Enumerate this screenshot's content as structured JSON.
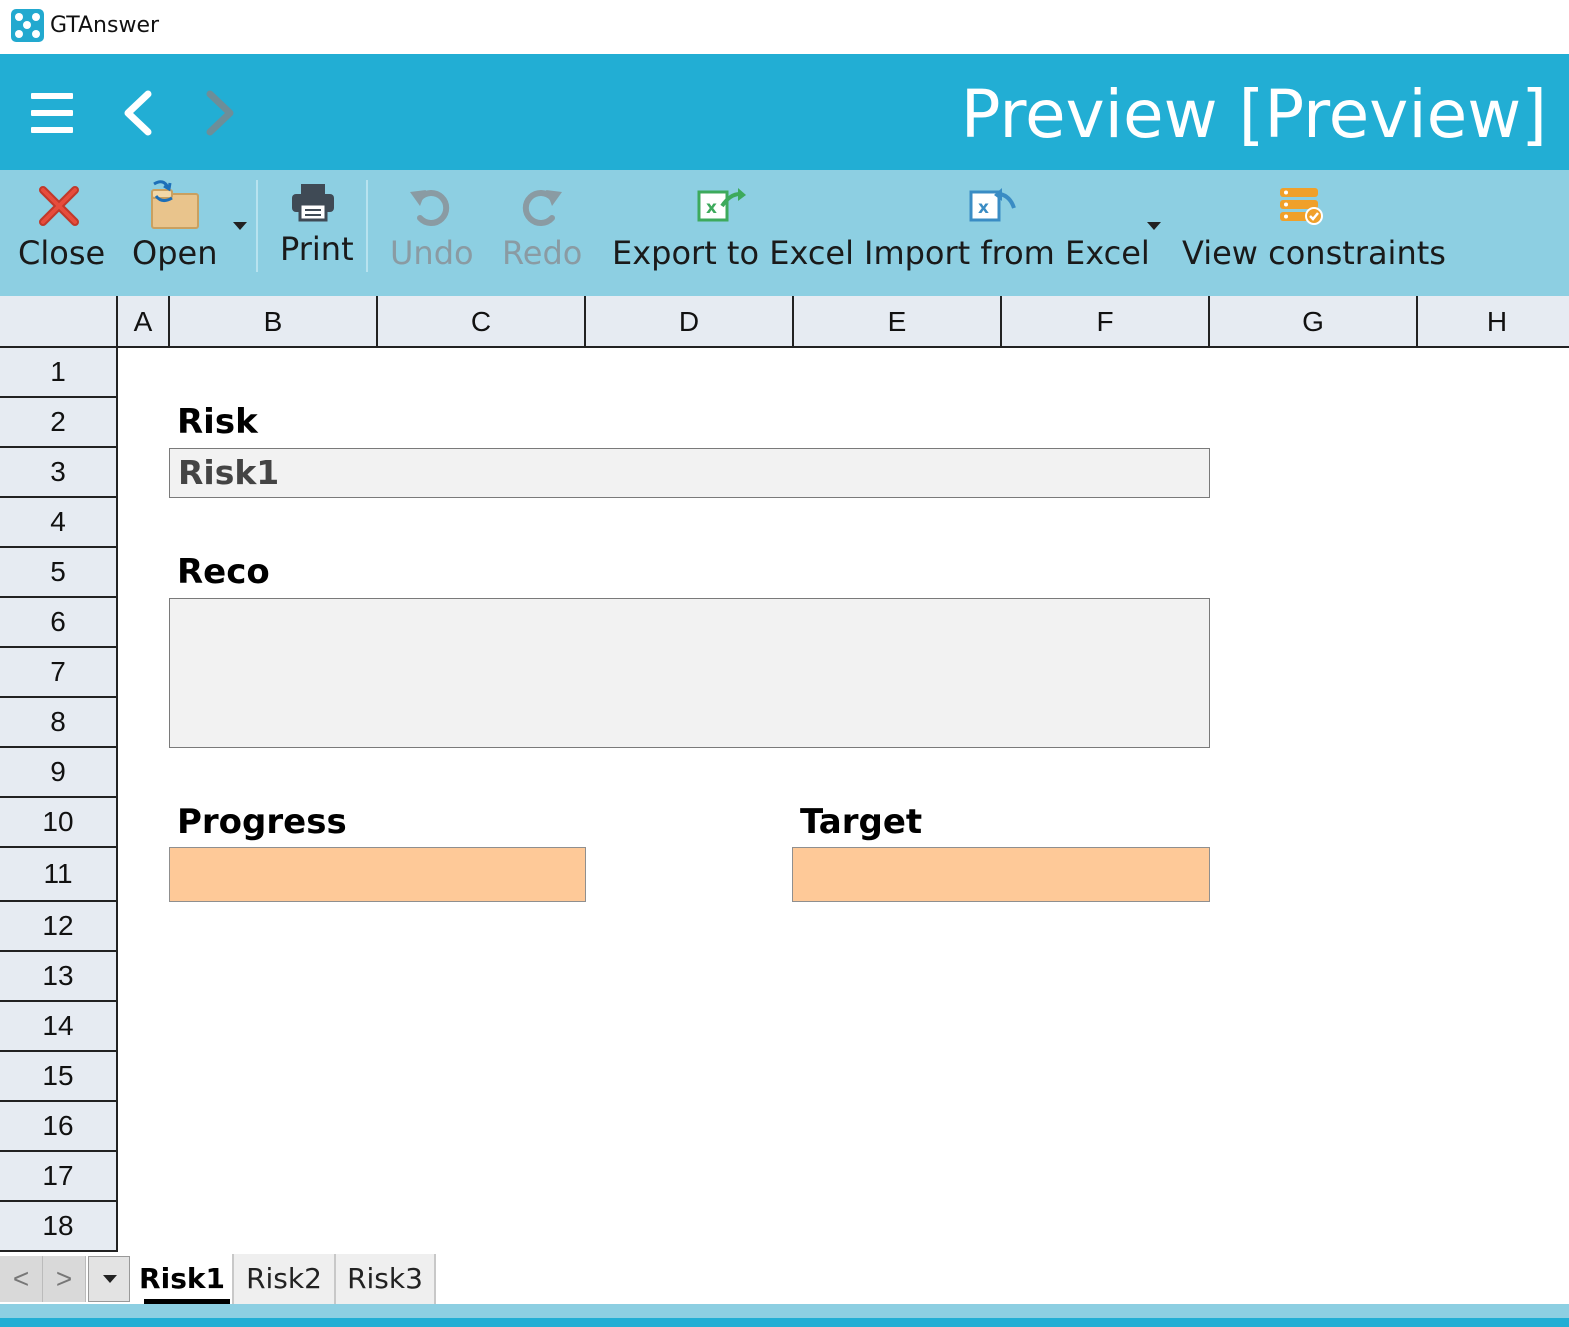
{
  "app": {
    "title": "GTAnswer"
  },
  "header": {
    "title": "Preview [Preview]"
  },
  "toolbar": {
    "close": "Close",
    "open": "Open",
    "print": "Print",
    "undo": "Undo",
    "redo": "Redo",
    "export": "Export to Excel",
    "import": "Import from Excel",
    "constraints": "View constraints"
  },
  "grid": {
    "columns": [
      "A",
      "B",
      "C",
      "D",
      "E",
      "F",
      "G",
      "H"
    ],
    "rows": [
      "1",
      "2",
      "3",
      "4",
      "5",
      "6",
      "7",
      "8",
      "9",
      "10",
      "11",
      "12",
      "13",
      "14",
      "15",
      "16",
      "17",
      "18"
    ]
  },
  "form": {
    "risk_label": "Risk",
    "risk_value": "Risk1",
    "reco_label": "Reco",
    "reco_value": "",
    "progress_label": "Progress",
    "progress_value": "",
    "target_label": "Target",
    "target_value": ""
  },
  "sheets": {
    "prev": "<",
    "next": ">",
    "tabs": [
      "Risk1",
      "Risk2",
      "Risk3"
    ],
    "active": "Risk1"
  },
  "colors": {
    "header": "#22aed4",
    "toolbar": "#8dcfe2",
    "input_gray": "#f2f2f2",
    "input_orange": "#fec998"
  }
}
